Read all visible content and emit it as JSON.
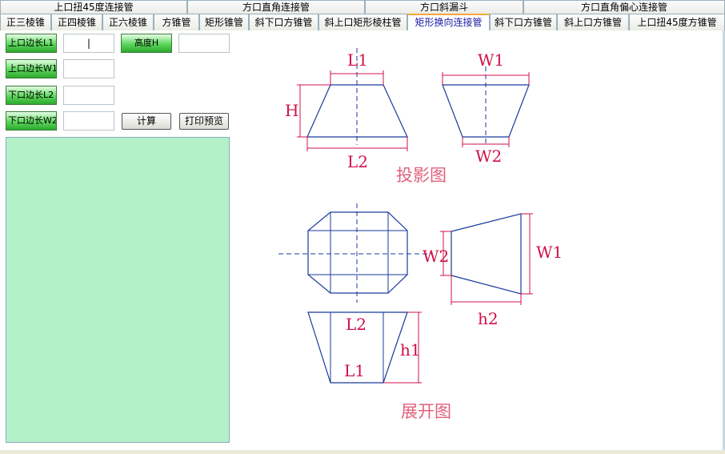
{
  "tabs_row1": [
    "上口扭45度连接管",
    "方口直角连接管",
    "方口斜漏斗",
    "方口直角偏心连接管"
  ],
  "tabs_row2": [
    "正三棱锥",
    "正四棱锥",
    "正六棱锥",
    "方锥管",
    "矩形锥管",
    "斜下口方锥管",
    "斜上口矩形棱柱管",
    "矩形换向连接管",
    "斜下口方锥管",
    "斜上口方锥管",
    "上口扭45度方锥管"
  ],
  "active_tab": "矩形换向连接管",
  "form": {
    "l1_label": "上口边长L1",
    "w1_label": "上口边长W1",
    "l2_label": "下口边长L2",
    "w2_label": "下口边长W2",
    "h_label": "高度H",
    "l1_value": "|",
    "w1_value": "",
    "l2_value": "",
    "w2_value": "",
    "h_value": "",
    "calc_label": "计算",
    "print_label": "打印预览"
  },
  "diagram": {
    "proj_l1": "L1",
    "proj_h": "H",
    "proj_l2": "L2",
    "proj_w1": "W1",
    "proj_w2": "W2",
    "proj_caption": "投影图",
    "unf_w2": "W2",
    "unf_w1": "W1",
    "unf_h2": "h2",
    "unf_l2": "L2",
    "unf_l1": "L1",
    "unf_h1": "h1",
    "unf_caption": "展开图"
  },
  "colors": {
    "dim_line": "#d0104a",
    "outline": "#1a3a9c",
    "text_label": "#d0104a",
    "caption": "#e0607a",
    "output_bg": "#b4f0c8"
  }
}
